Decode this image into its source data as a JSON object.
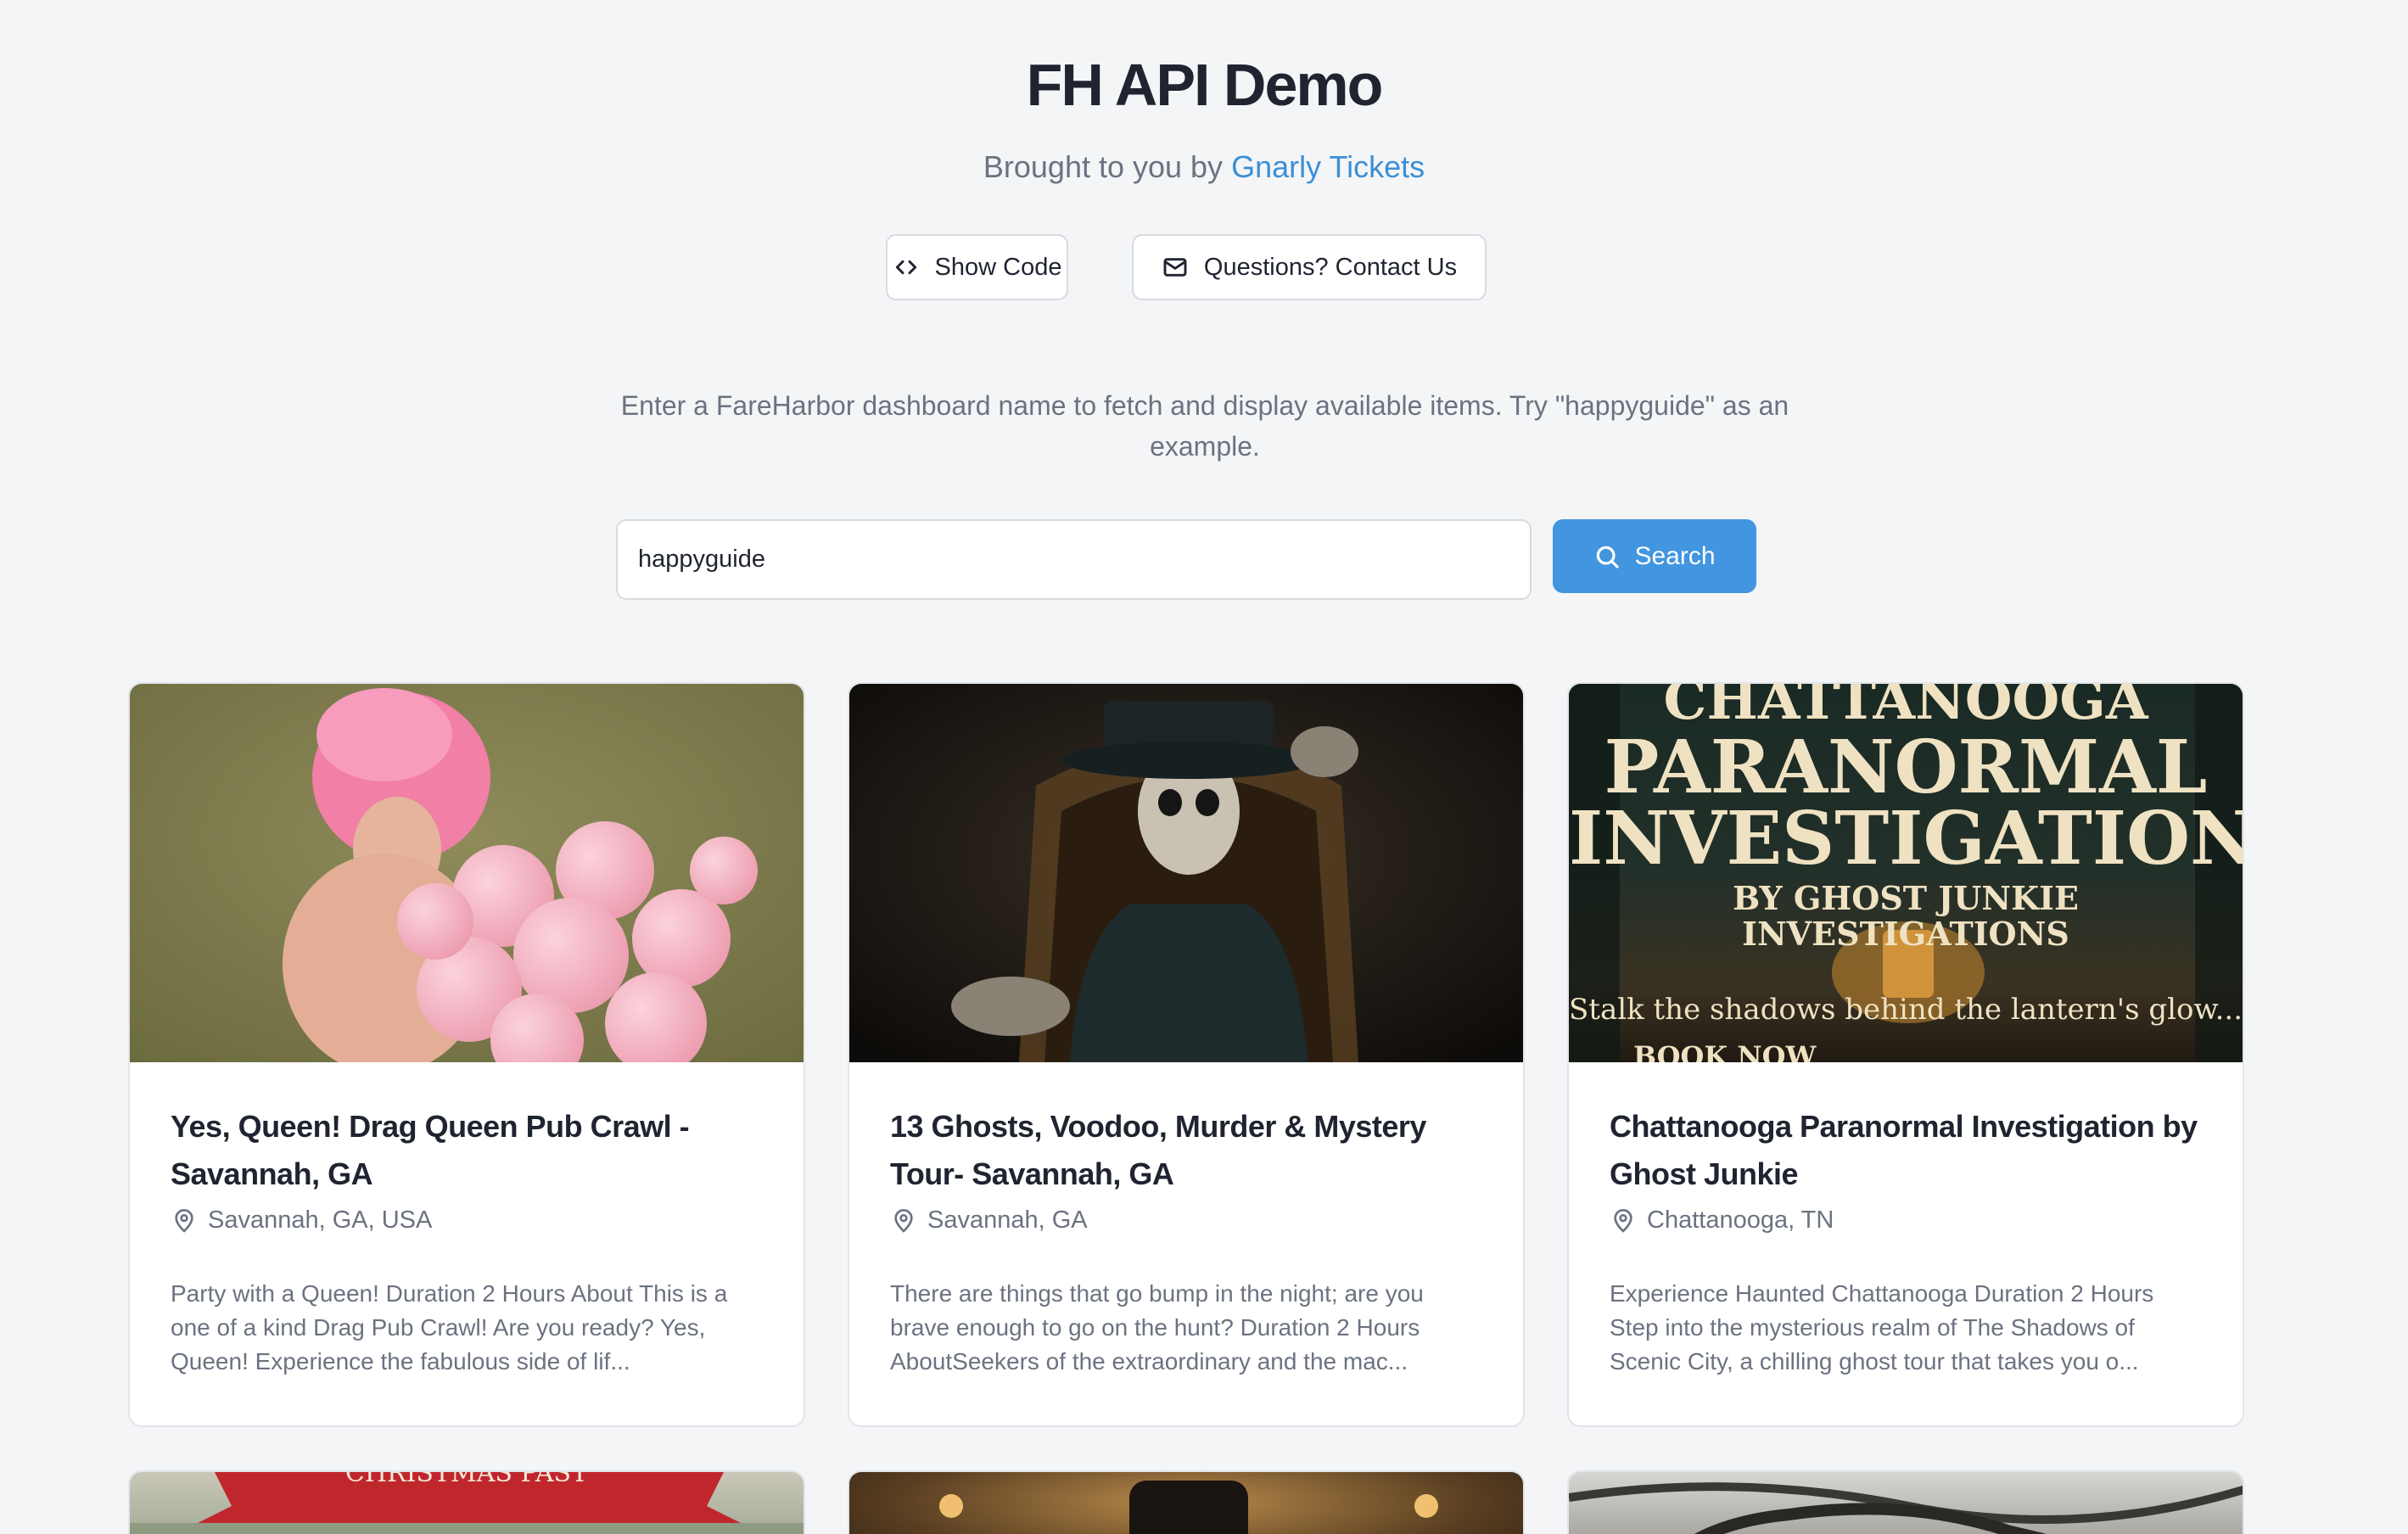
{
  "header": {
    "title": "FH API Demo",
    "subtitle_prefix": "Brought to you by ",
    "brand_link": "Gnarly Tickets"
  },
  "actions": {
    "show_code": "Show Code",
    "contact": "Questions? Contact Us"
  },
  "instructions": "Enter a FareHarbor dashboard name to fetch and display available items. Try \"happyguide\" as an example.",
  "search": {
    "value": "happyguide",
    "button_label": "Search"
  },
  "icons": {
    "show_code": "code-icon",
    "contact": "mail-icon",
    "search": "search-icon",
    "location": "map-pin-icon"
  },
  "colors": {
    "accent": "#4295df",
    "link": "#3b8fd6",
    "background": "#f4f5f7"
  },
  "cards": [
    {
      "title": "Yes, Queen! Drag Queen Pub Crawl - Savannah, GA",
      "location": "Savannah, GA, USA",
      "description": "Party with a Queen! Duration 2 Hours About This is a one of a kind Drag Pub Crawl! Are you ready? Yes, Queen! Experience the fabulous side of lif..."
    },
    {
      "title": "13 Ghosts, Voodoo, Murder & Mystery Tour- Savannah, GA",
      "location": "Savannah, GA",
      "description": "There are things that go bump in the night; are you brave enough to go on the hunt? Duration 2 Hours AboutSeekers of the extraordinary and the mac..."
    },
    {
      "title": "Chattanooga Paranormal Investigation by Ghost Junkie",
      "location": "Chattanooga, TN",
      "description": "Experience Haunted Chattanooga Duration 2 Hours Step into the mysterious realm of The Shadows of Scenic City, a chilling ghost tour that takes you o..."
    }
  ],
  "poster3": {
    "line1": "CHATTANOOGA",
    "line2": "PARANORMAL",
    "line3": "INVESTIGATION",
    "line4": "BY GHOST JUNKIE",
    "line5": "INVESTIGATIONS",
    "tagline": "Stalk the shadows behind the lantern's glow...",
    "cta": "BOOK NOW"
  },
  "poster4": {
    "banner": "CHRISTMAS PAST"
  }
}
